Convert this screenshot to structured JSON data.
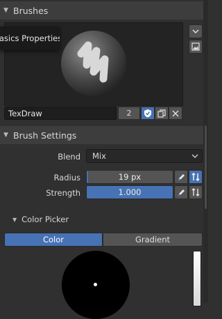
{
  "brushes_panel": {
    "title": "Brushes",
    "tooltip": "Basics Properties",
    "brush_name": "TexDraw",
    "user_count": "2"
  },
  "brush_settings_panel": {
    "title": "Brush Settings",
    "blend": {
      "label": "Blend",
      "value": "Mix"
    },
    "radius": {
      "label": "Radius",
      "value": "19 px"
    },
    "strength": {
      "label": "Strength",
      "value": "1.000",
      "fill_fraction": 1.0
    }
  },
  "color_picker": {
    "title": "Color Picker",
    "tabs": [
      {
        "label": "Color",
        "active": true
      },
      {
        "label": "Gradient",
        "active": false
      }
    ],
    "current_color": "#000000"
  },
  "colors": {
    "accent": "#4772b3",
    "panel_bg": "#303030",
    "header_bg": "#3d3d3d"
  }
}
